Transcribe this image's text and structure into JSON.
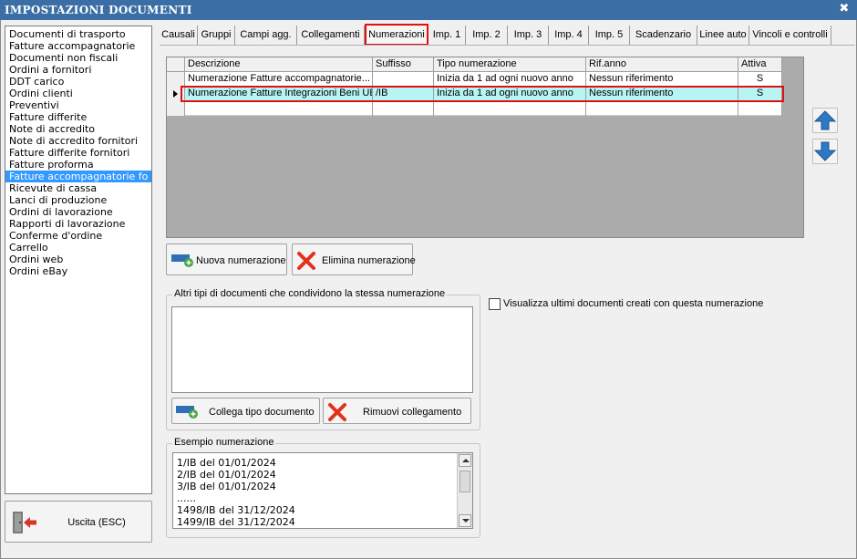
{
  "window": {
    "title": "IMPOSTAZIONI DOCUMENTI",
    "close_glyph": "✖"
  },
  "doc_types": [
    "Documenti di trasporto",
    "Fatture accompagnatorie",
    "Documenti non fiscali",
    "Ordini a fornitori",
    "DDT carico",
    "Ordini clienti",
    "Preventivi",
    "Fatture differite",
    "Note di accredito",
    "Note di accredito fornitori",
    "Fatture differite fornitori",
    "Fatture proforma",
    "Fatture accompagnatorie fo",
    "Ricevute di cassa",
    "Lanci di produzione",
    "Ordini di lavorazione",
    "Rapporti di lavorazione",
    "Conferme d'ordine",
    "Carrello",
    "Ordini web",
    "Ordini eBay"
  ],
  "selected_doc_type": "Fatture accompagnatorie fo",
  "exit_button": {
    "label": "Uscita (ESC)",
    "icon": "exit-door-icon"
  },
  "tabs": [
    {
      "label": "Causali",
      "active": false
    },
    {
      "label": "Gruppi",
      "active": false
    },
    {
      "label": "Campi agg.",
      "active": false
    },
    {
      "label": "Collegamenti",
      "active": false
    },
    {
      "label": "Numerazioni",
      "active": true
    },
    {
      "label": "Imp. 1",
      "active": false
    },
    {
      "label": "Imp. 2",
      "active": false
    },
    {
      "label": "Imp. 3",
      "active": false
    },
    {
      "label": "Imp. 4",
      "active": false
    },
    {
      "label": "Imp. 5",
      "active": false
    },
    {
      "label": "Scadenzario",
      "active": false
    },
    {
      "label": "Linee auto",
      "active": false
    },
    {
      "label": "Vincoli e controlli",
      "active": false
    }
  ],
  "grid": {
    "columns": [
      "Descrizione",
      "Suffisso",
      "Tipo numerazione",
      "Rif.anno",
      "Attiva"
    ],
    "rows": [
      {
        "descrizione": "Numerazione Fatture accompagnatorie...",
        "suffisso": "",
        "tipo": "Inizia da 1 ad ogni nuovo anno",
        "rif_anno": "Nessun riferimento",
        "attiva": "S",
        "selected": false
      },
      {
        "descrizione": "Numerazione Fatture Integrazioni Beni UE",
        "suffisso": "/IB",
        "tipo": "Inizia da 1 ad ogni nuovo anno",
        "rif_anno": "Nessun riferimento",
        "attiva": "S",
        "selected": true
      }
    ]
  },
  "buttons": {
    "nuova": "Nuova numerazione",
    "elimina": "Elimina numerazione",
    "collega": "Collega tipo documento",
    "rimuovi": "Rimuovi collegamento"
  },
  "shared_group": {
    "legend": "Altri tipi di documenti che condividono la stessa numerazione"
  },
  "checkbox": {
    "label": "Visualizza ultimi documenti creati con questa numerazione",
    "checked": false
  },
  "example_group": {
    "legend": "Esempio numerazione",
    "lines": [
      "1/IB del 01/01/2024",
      "2/IB del 01/01/2024",
      "3/IB del 01/01/2024",
      "......",
      "1498/IB del 31/12/2024",
      "1499/IB del 31/12/2024"
    ]
  },
  "colors": {
    "title_bar": "#3a6ea5",
    "selection": "#3399ff",
    "grid_selected": "#b7f4f4",
    "highlight_outline": "#e01010",
    "arrow_blue": "#2f78c4"
  }
}
